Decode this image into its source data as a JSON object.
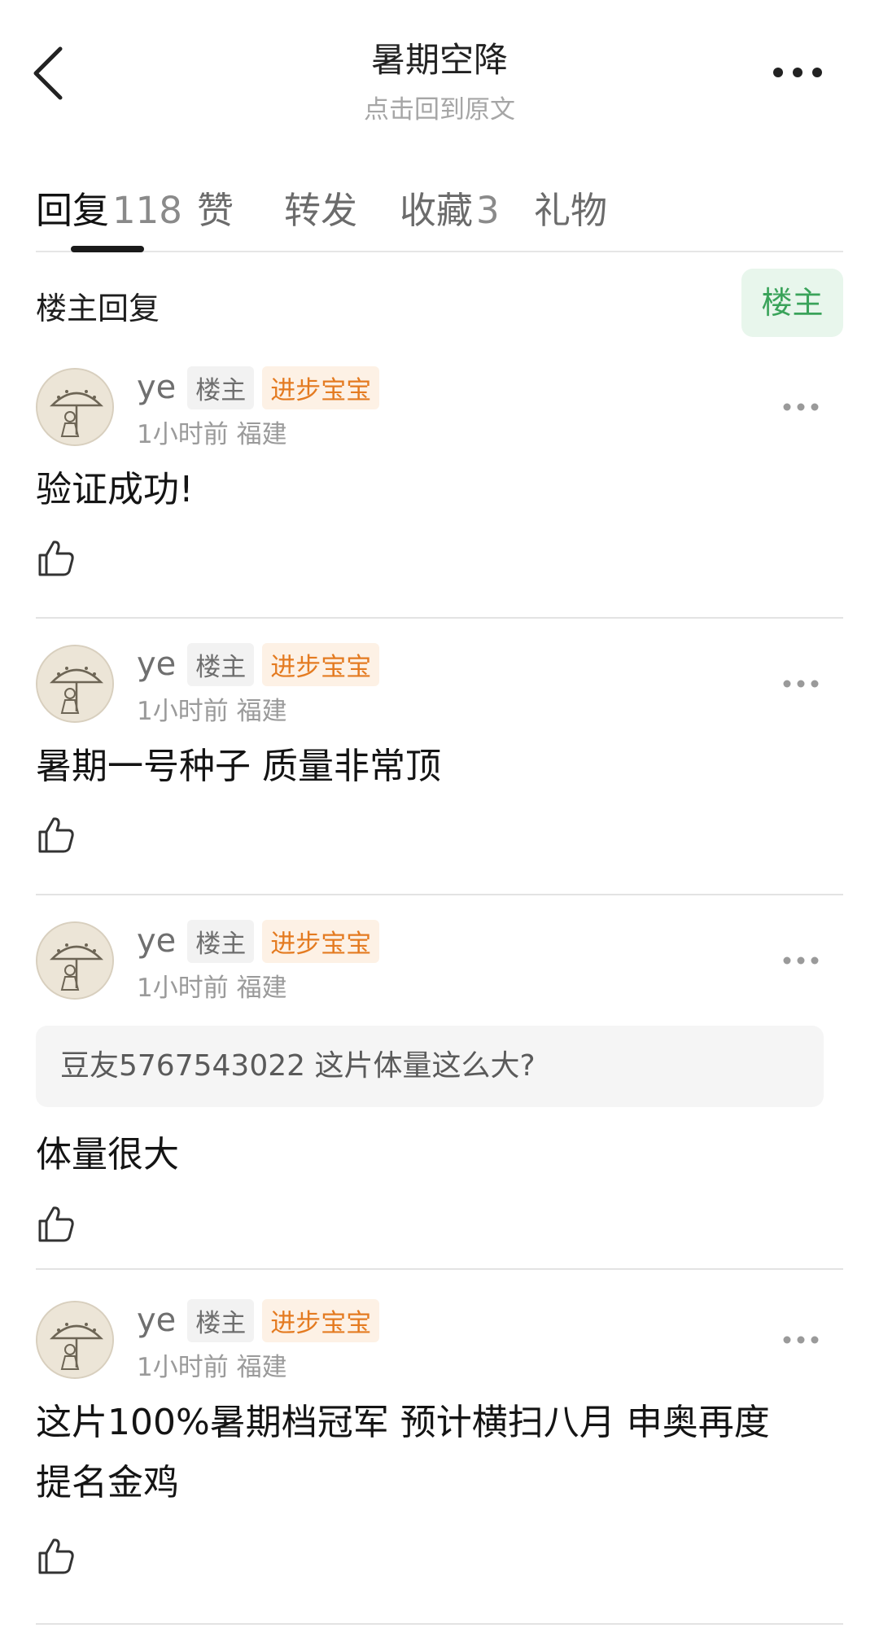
{
  "header": {
    "title": "暑期空降",
    "subtitle": "点击回到原文",
    "back_icon": "chevron-left-icon",
    "more_icon": "more-horizontal-icon"
  },
  "tabs": [
    {
      "label": "回复",
      "count": "118"
    },
    {
      "label": "赞",
      "count": ""
    },
    {
      "label": "转发",
      "count": ""
    },
    {
      "label": "收藏",
      "count": "3"
    },
    {
      "label": "礼物",
      "count": ""
    }
  ],
  "filter": {
    "label": "楼主回复",
    "chip": "楼主"
  },
  "comments": [
    {
      "username": "ye",
      "badge_op": "楼主",
      "badge_level": "进步宝宝",
      "meta": "1小时前 福建",
      "quote": "",
      "text_lines": [
        "验证成功!"
      ]
    },
    {
      "username": "ye",
      "badge_op": "楼主",
      "badge_level": "进步宝宝",
      "meta": "1小时前 福建",
      "quote": "",
      "text_lines": [
        "暑期一号种子 质量非常顶"
      ]
    },
    {
      "username": "ye",
      "badge_op": "楼主",
      "badge_level": "进步宝宝",
      "meta": "1小时前 福建",
      "quote": "豆友5767543022 这片体量这么大?",
      "text_lines": [
        "体量很大"
      ]
    },
    {
      "username": "ye",
      "badge_op": "楼主",
      "badge_level": "进步宝宝",
      "meta": "1小时前 福建",
      "quote": "",
      "text_lines": [
        "这片100%暑期档冠军 预计横扫八月 申奥再度",
        "提名金鸡"
      ]
    }
  ],
  "colors": {
    "accent_green": "#3aa35a",
    "chip_bg": "#e8f6ec",
    "level_orange": "#e47b21",
    "level_bg": "#fdf1e5"
  }
}
